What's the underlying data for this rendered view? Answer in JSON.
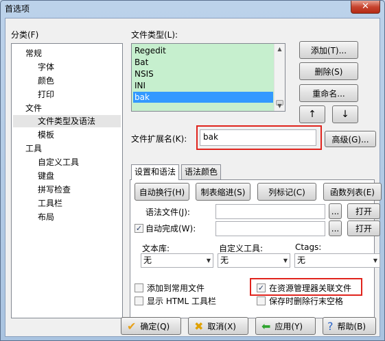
{
  "window": {
    "title": "首选项",
    "close_label": "✕"
  },
  "category": {
    "label": "分类(F)",
    "items": [
      {
        "label": "常规",
        "level": 0
      },
      {
        "label": "字体",
        "level": 1
      },
      {
        "label": "颜色",
        "level": 1
      },
      {
        "label": "打印",
        "level": 1
      },
      {
        "label": "文件",
        "level": 0
      },
      {
        "label": "文件类型及语法",
        "level": 1,
        "selected": true
      },
      {
        "label": "模板",
        "level": 1
      },
      {
        "label": "工具",
        "level": 0
      },
      {
        "label": "自定义工具",
        "level": 1
      },
      {
        "label": "键盘",
        "level": 1
      },
      {
        "label": "拼写检查",
        "level": 1
      },
      {
        "label": "工具栏",
        "level": 1
      },
      {
        "label": "布局",
        "level": 1
      }
    ]
  },
  "file_types": {
    "label": "文件类型(L):",
    "items": [
      "Regedit",
      "Bat",
      "NSIS",
      "INI",
      "bak"
    ],
    "selected": "bak",
    "buttons": {
      "add": "添加(T)...",
      "delete": "删除(S)",
      "rename": "重命名...",
      "up": "↑",
      "down": "↓"
    }
  },
  "extension": {
    "label": "文件扩展名(K):",
    "value": "bak",
    "advanced": "高级(G)..."
  },
  "tabs": {
    "syntax": "设置和语法",
    "colors": "语法颜色"
  },
  "panel": {
    "auto_wrap": "自动换行(H)",
    "tab_indent": "制表缩进(S)",
    "column_marker": "列标记(C)",
    "function_list": "函数列表(E)",
    "syntax_file_label": "语法文件(J):",
    "syntax_file_value": "",
    "auto_complete_label": "自动完成(W):",
    "auto_complete_checked": true,
    "auto_complete_value": "",
    "browse": "...",
    "open": "打开",
    "library_label": "文本库:",
    "custom_tools_label": "自定义工具:",
    "ctags_label": "Ctags:",
    "library_value": "无",
    "custom_tools_value": "无",
    "ctags_value": "无",
    "add_recent": "添加到常用文件",
    "show_html_toolbar": "显示 HTML 工具栏",
    "explorer_assoc": "在资源管理器关联文件",
    "explorer_assoc_checked": true,
    "strip_trailing": "保存时删除行末空格"
  },
  "footer": {
    "ok": "确定(Q)",
    "cancel": "取消(X)",
    "apply": "应用(Y)",
    "help": "帮助(B)"
  },
  "colors": {
    "list_bg": "#c6efce",
    "selected_bg": "#3399ff",
    "highlight": "#e0231c"
  }
}
